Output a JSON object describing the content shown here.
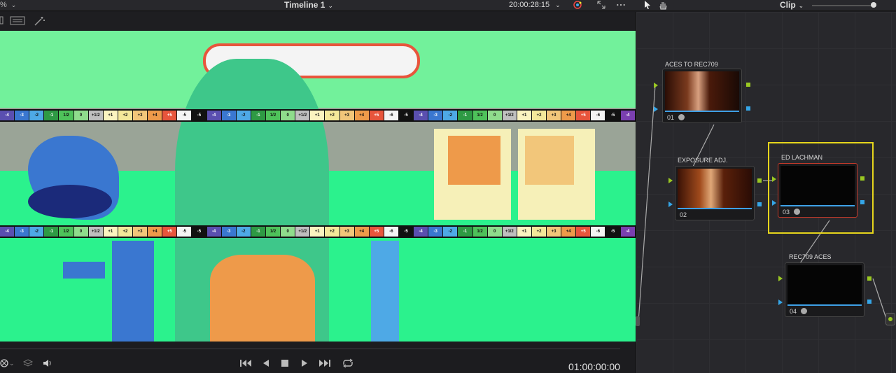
{
  "topbar": {
    "zoom": "%",
    "timeline_title": "Timeline 1",
    "timecode": "20:00:28:15",
    "panel_mode": "Clip"
  },
  "viewer": {
    "chart_labels": [
      "-4",
      "-3",
      "-2",
      "-1",
      "1/2",
      "0",
      "+1/2",
      "+1",
      "+2",
      "+3",
      "+4",
      "+5",
      "-5",
      "-5",
      "-4",
      "-3",
      "-2",
      "-1",
      "1/2",
      "0",
      "+1/2",
      "+1",
      "+2",
      "+3",
      "+4",
      "+5",
      "-6",
      "-5",
      "-4",
      "-3",
      "-2",
      "-1",
      "1/2",
      "0",
      "+1/2",
      "+1",
      "+2",
      "+3",
      "+4",
      "+5",
      "-6",
      "-5",
      "-4"
    ],
    "chart_colors": [
      "#5a4fb0",
      "#3a77d0",
      "#4ea9e6",
      "#2e9a44",
      "#4ec25a",
      "#8fdc8c",
      "#bfbfbf",
      "#fbf4c0",
      "#f4e89a",
      "#f2c67a",
      "#ee9a4a",
      "#e8553c",
      "#f4f4f4",
      "#111111",
      "#5a4fb0",
      "#3a77d0",
      "#4ea9e6",
      "#2e9a44",
      "#4ec25a",
      "#8fdc8c",
      "#bfbfbf",
      "#fbf4c0",
      "#f4e89a",
      "#f2c67a",
      "#ee9a4a",
      "#e8553c",
      "#f4f4f4",
      "#111111",
      "#5a4fb0",
      "#3a77d0",
      "#4ea9e6",
      "#2e9a44",
      "#4ec25a",
      "#8fdc8c",
      "#bfbfbf",
      "#fbf4c0",
      "#f4e89a",
      "#f2c67a",
      "#ee9a4a",
      "#e8553c",
      "#f4f4f4",
      "#111111",
      "#7a3fb0"
    ]
  },
  "transport": {
    "timecode": "01:00:00:00"
  },
  "nodes": [
    {
      "label": "ACES TO REC709",
      "num": "01"
    },
    {
      "label": "EXPOSURE ADJ.",
      "num": "02"
    },
    {
      "label": "ED LACHMAN",
      "num": "03"
    },
    {
      "label": "REC709 ACES",
      "num": "04"
    }
  ],
  "colors": {
    "viewer_bg": "#2bf28d",
    "selection": "#e6d51c",
    "pin_green": "#9ac822",
    "pin_blue": "#35a6e8"
  }
}
